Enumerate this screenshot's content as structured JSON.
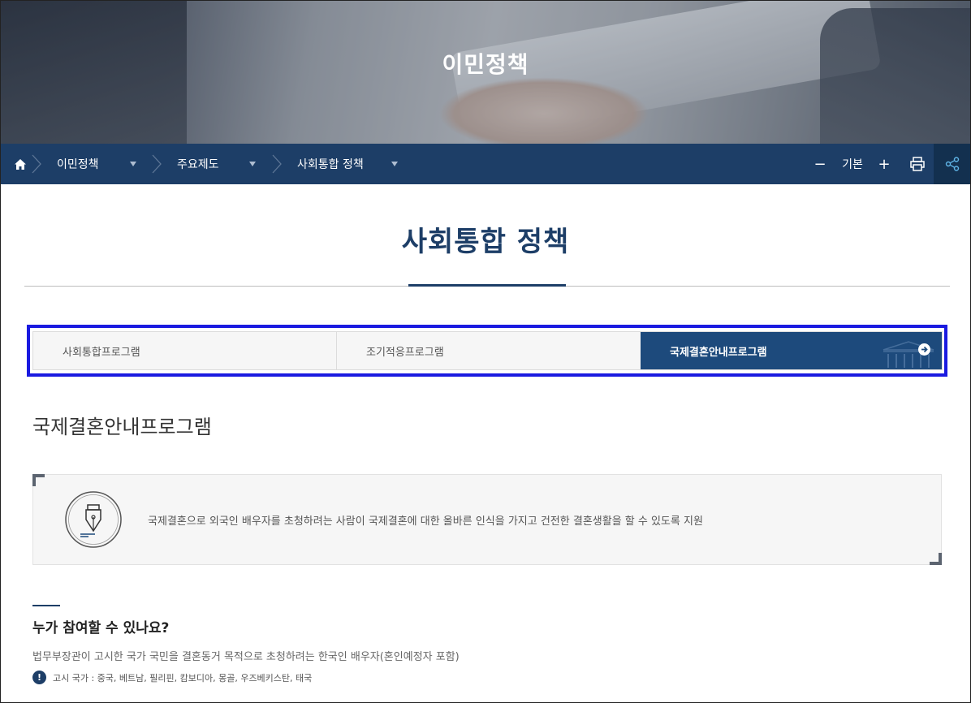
{
  "hero": {
    "title": "이민정책"
  },
  "breadcrumb": {
    "home_icon": "home-icon",
    "items": [
      {
        "label": "이민정책"
      },
      {
        "label": "주요제도"
      },
      {
        "label": "사회통합 정책"
      }
    ]
  },
  "toolbar": {
    "zoom_out": "−",
    "zoom_level": "기본",
    "zoom_in": "+",
    "print_icon": "printer-icon",
    "share_icon": "share-icon"
  },
  "page": {
    "title": "사회통합 정책"
  },
  "tabs": [
    {
      "label": "사회통합프로그램",
      "active": false
    },
    {
      "label": "조기적응프로그램",
      "active": false
    },
    {
      "label": "국제결혼안내프로그램",
      "active": true
    }
  ],
  "section": {
    "title": "국제결혼안내프로그램",
    "summary_icon": "fountain-pen-icon",
    "summary": "국제결혼으로 외국인 배우자를 초청하려는 사람이 국제결혼에 대한 올바른 인식을 가지고 건전한 결혼생활을 할 수 있도록 지원"
  },
  "who": {
    "title": "누가 참여할 수 있나요?",
    "description": "법무부장관이 고시한 국가 국민을 결혼동거 목적으로 초청하려는 한국인 배우자(혼인예정자 포함)",
    "notice_symbol": "!",
    "notice": "고시 국가 : 중국, 베트남, 필리핀, 캄보디아, 몽골, 우즈베키스탄, 태국"
  },
  "colors": {
    "nav_bg": "#1d3e67",
    "active_tab": "#1d4a7c",
    "highlight_outline": "#1a1ae0"
  }
}
